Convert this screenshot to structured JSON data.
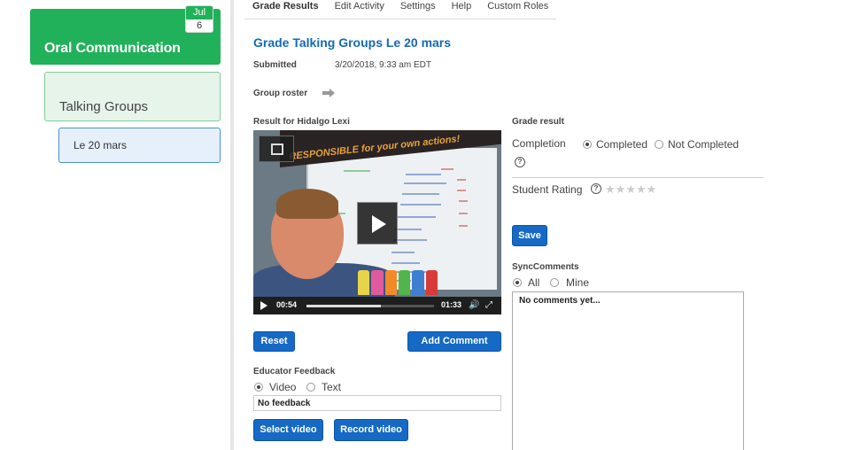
{
  "sidebar": {
    "course": {
      "title": "Oral Communication",
      "date_month": "Jul",
      "date_day": "6"
    },
    "group": {
      "title": "Talking Groups"
    },
    "activity": {
      "title": "Le 20 mars"
    }
  },
  "tabs": [
    {
      "label": "Grade Results",
      "active": true
    },
    {
      "label": "Edit Activity"
    },
    {
      "label": "Settings"
    },
    {
      "label": "Help"
    },
    {
      "label": "Custom Roles"
    }
  ],
  "page": {
    "title": "Grade Talking Groups Le 20 mars",
    "submitted_label": "Submitted",
    "submitted_value": "3/20/2018, 9:33 am EDT",
    "group_roster_label": "Group roster"
  },
  "result": {
    "label": "Result for Hidalgo Lexi",
    "video": {
      "current_time": "00:54",
      "duration": "01:33",
      "progress": 0.58,
      "banner_text": "RESPONSIBLE for your own actions!"
    },
    "reset_label": "Reset",
    "add_comment_label": "Add Comment"
  },
  "educator_feedback": {
    "label": "Educator Feedback",
    "options": [
      {
        "label": "Video",
        "selected": true
      },
      {
        "label": "Text",
        "selected": false
      }
    ],
    "value": "No feedback",
    "select_video_label": "Select video",
    "record_video_label": "Record video"
  },
  "grade_result": {
    "label": "Grade result",
    "completion_label": "Completion",
    "completion_options": [
      {
        "label": "Completed",
        "selected": true
      },
      {
        "label": "Not Completed",
        "selected": false
      }
    ],
    "student_rating_label": "Student Rating",
    "rating": 0,
    "rating_max": 5,
    "save_label": "Save"
  },
  "sync_comments": {
    "label": "SyncComments",
    "filter_options": [
      {
        "label": "All",
        "selected": true
      },
      {
        "label": "Mine",
        "selected": false
      }
    ],
    "empty_text": "No comments yet..."
  },
  "colors": {
    "course_green": "#20b15a",
    "link_blue": "#1469b8",
    "button_blue": "#1669c5"
  }
}
